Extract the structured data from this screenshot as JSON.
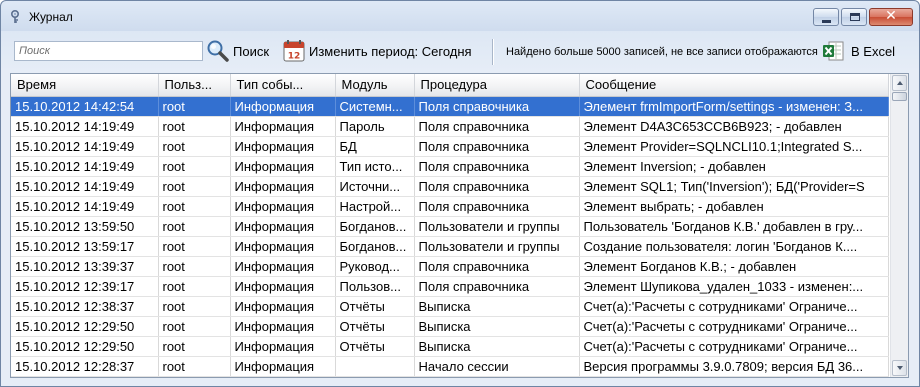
{
  "window": {
    "title": "Журнал"
  },
  "toolbar": {
    "search_placeholder": "Поиск",
    "search_label": "Поиск",
    "period_label": "Изменить период: Сегодня",
    "calendar_day": "12",
    "notice": "Найдено больше 5000 записей, не все записи отображаются",
    "excel_label": "В Excel"
  },
  "grid": {
    "columns": [
      "Время",
      "Польз...",
      "Тип собы...",
      "Модуль",
      "Процедура",
      "Сообщение"
    ],
    "rows": [
      {
        "time": "15.10.2012 14:42:54",
        "user": "root",
        "type": "Информация",
        "module": "Системн...",
        "procedure": "Поля справочника",
        "message": "Элемент frmImportForm/settings - изменен: З..."
      },
      {
        "time": "15.10.2012 14:19:49",
        "user": "root",
        "type": "Информация",
        "module": "Пароль",
        "procedure": "Поля справочника",
        "message": "Элемент D4A3C653CCB6B923;  - добавлен"
      },
      {
        "time": "15.10.2012 14:19:49",
        "user": "root",
        "type": "Информация",
        "module": "БД",
        "procedure": "Поля справочника",
        "message": "Элемент Provider=SQLNCLI10.1;Integrated S..."
      },
      {
        "time": "15.10.2012 14:19:49",
        "user": "root",
        "type": "Информация",
        "module": "Тип исто...",
        "procedure": "Поля справочника",
        "message": "Элемент Inversion;  - добавлен"
      },
      {
        "time": "15.10.2012 14:19:49",
        "user": "root",
        "type": "Информация",
        "module": "Источни...",
        "procedure": "Поля справочника",
        "message": "Элемент SQL1; Тип('Inversion'); БД('Provider=S"
      },
      {
        "time": "15.10.2012 14:19:49",
        "user": "root",
        "type": "Информация",
        "module": "Настрой...",
        "procedure": "Поля справочника",
        "message": "Элемент выбрать;  - добавлен"
      },
      {
        "time": "15.10.2012 13:59:50",
        "user": "root",
        "type": "Информация",
        "module": "Богданов...",
        "procedure": "Пользователи и группы",
        "message": "Пользователь 'Богданов К.В.' добавлен в гру..."
      },
      {
        "time": "15.10.2012 13:59:17",
        "user": "root",
        "type": "Информация",
        "module": "Богданов...",
        "procedure": "Пользователи и группы",
        "message": "Создание пользователя: логин 'Богданов К...."
      },
      {
        "time": "15.10.2012 13:39:37",
        "user": "root",
        "type": "Информация",
        "module": "Руковод...",
        "procedure": "Поля справочника",
        "message": "Элемент Богданов К.В.;  - добавлен"
      },
      {
        "time": "15.10.2012 12:39:17",
        "user": "root",
        "type": "Информация",
        "module": "Пользов...",
        "procedure": "Поля справочника",
        "message": "Элемент Шупикова_удален_1033 - изменен:..."
      },
      {
        "time": "15.10.2012 12:38:37",
        "user": "root",
        "type": "Информация",
        "module": "Отчёты",
        "procedure": "Выписка",
        "message": "Счет(а):'Расчеты с сотрудниками' Ограниче..."
      },
      {
        "time": "15.10.2012 12:29:50",
        "user": "root",
        "type": "Информация",
        "module": "Отчёты",
        "procedure": "Выписка",
        "message": "Счет(а):'Расчеты с сотрудниками' Ограниче..."
      },
      {
        "time": "15.10.2012 12:29:50",
        "user": "root",
        "type": "Информация",
        "module": "Отчёты",
        "procedure": "Выписка",
        "message": "Счет(а):'Расчеты с сотрудниками' Ограниче..."
      },
      {
        "time": "15.10.2012 12:28:37",
        "user": "root",
        "type": "Информация",
        "module": "",
        "procedure": "Начало сессии",
        "message": "Версия программы 3.9.0.7809; версия БД 36..."
      }
    ]
  },
  "colors": {
    "selection": "#3370d0",
    "frame": "#6f85a4",
    "excel_green": "#1f7a3a"
  }
}
